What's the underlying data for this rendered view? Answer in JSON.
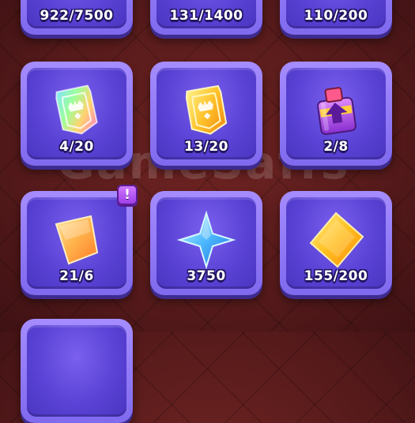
{
  "inventory": {
    "row1": [
      {
        "count": "922/7500",
        "icon": "coin-stack-icon"
      },
      {
        "count": "131/1400",
        "icon": "resource-icon"
      },
      {
        "count": "110/200",
        "icon": "resource-icon"
      }
    ],
    "row2": [
      {
        "count": "4/20",
        "icon": "rainbow-card-icon"
      },
      {
        "count": "13/20",
        "icon": "gold-card-icon"
      },
      {
        "count": "2/8",
        "icon": "potion-jar-icon"
      }
    ],
    "row3": [
      {
        "count": "21/6",
        "icon": "orange-shard-icon",
        "badge": "!"
      },
      {
        "count": "3750",
        "icon": "blue-star-icon"
      },
      {
        "count": "155/200",
        "icon": "gold-gem-icon"
      }
    ]
  },
  "watermark": "GameSaffs",
  "colors": {
    "background": "#561a1b",
    "tile": "#7f69ee",
    "tile_inner": "#5a43d6",
    "badge": "#b45af0"
  }
}
